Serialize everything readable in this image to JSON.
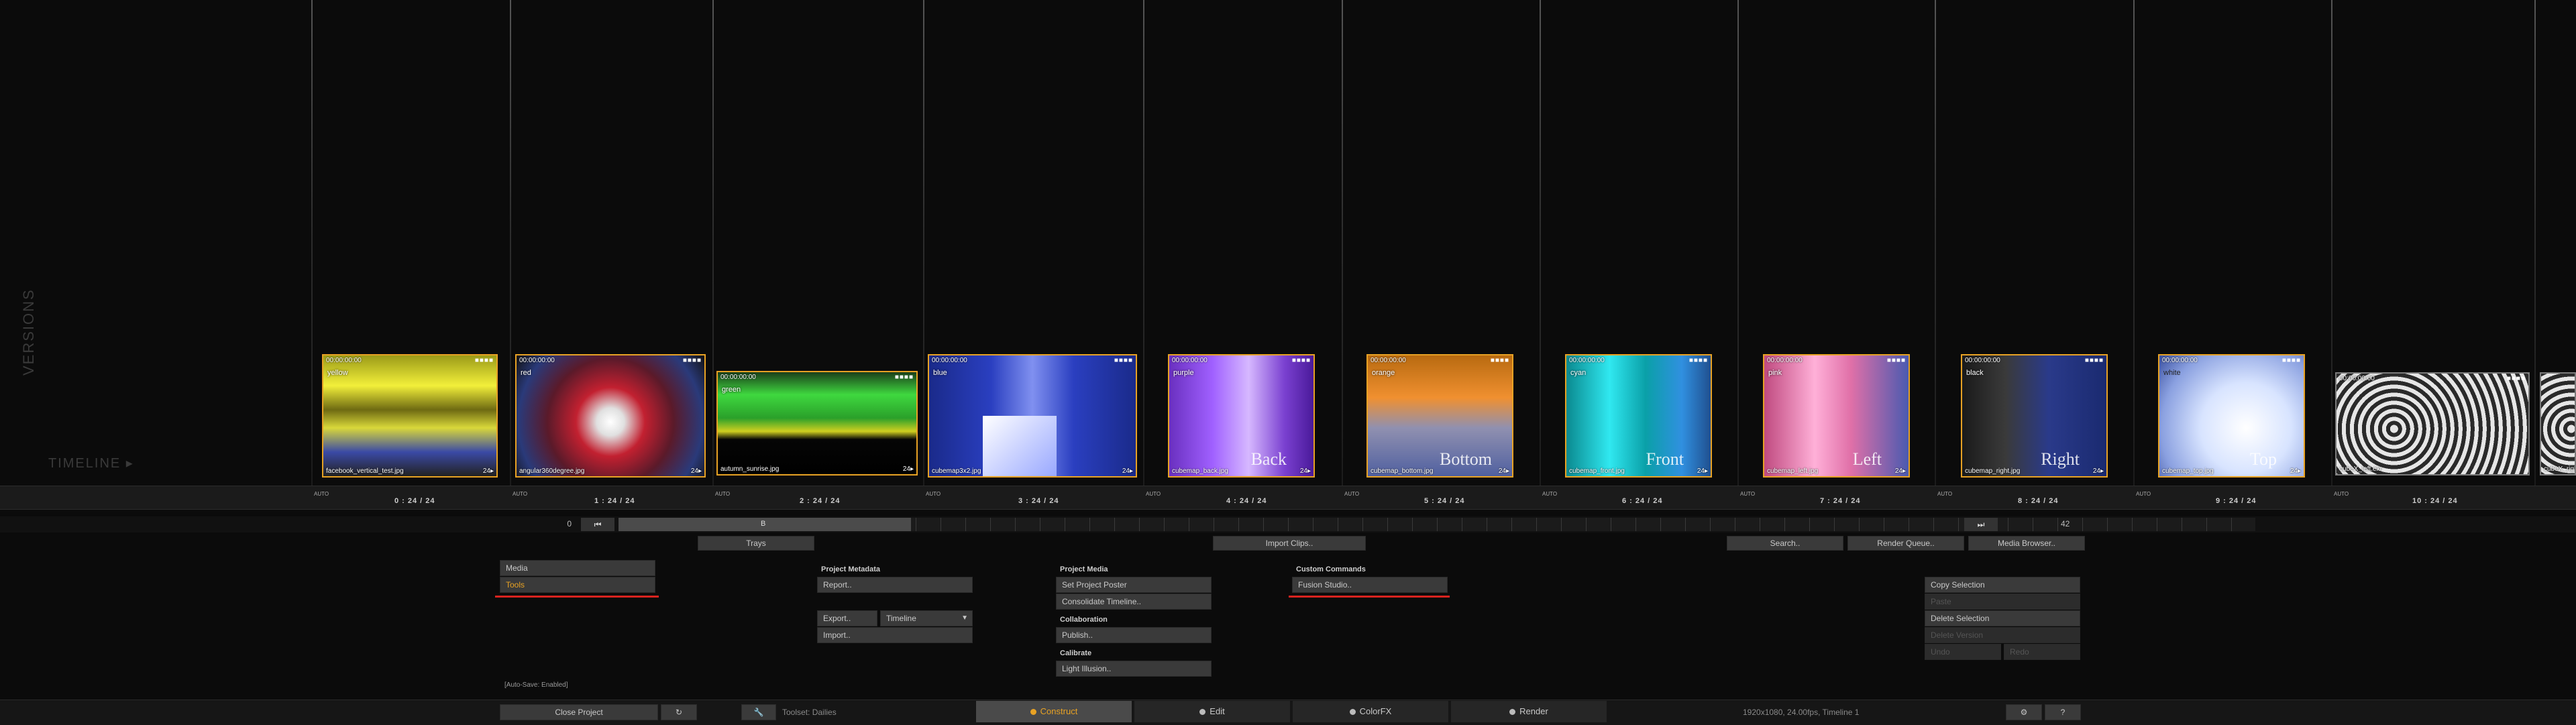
{
  "side": {
    "versions": "VERSIONS",
    "timeline": "TIMELINE ▸"
  },
  "clips": [
    {
      "tc": "00:00:00:00",
      "tag": "yellow",
      "file": "facebook_vertical_test.jpg",
      "badge": "24▸",
      "count": "0 : 24 / 24",
      "face": ""
    },
    {
      "tc": "00:00:00:00",
      "tag": "red",
      "file": "angular360degree.jpg",
      "badge": "24▸",
      "count": "1 : 24 / 24",
      "face": ""
    },
    {
      "tc": "00:00:00:00",
      "tag": "green",
      "file": "autumn_sunrise.jpg",
      "badge": "24▸",
      "count": "2 : 24 / 24",
      "face": ""
    },
    {
      "tc": "00:00:00:00",
      "tag": "blue",
      "file": "cubemap3x2.jpg",
      "badge": "24▸",
      "count": "3 : 24 / 24",
      "face": ""
    },
    {
      "tc": "00:00:00:00",
      "tag": "purple",
      "file": "cubemap_back.jpg",
      "badge": "24▸",
      "count": "4 : 24 / 24",
      "face": "Back"
    },
    {
      "tc": "00:00:00:00",
      "tag": "orange",
      "file": "cubemap_bottom.jpg",
      "badge": "24▸",
      "count": "5 : 24 / 24",
      "face": "Bottom"
    },
    {
      "tc": "00:00:00:00",
      "tag": "cyan",
      "file": "cubemap_front.jpg",
      "badge": "24▸",
      "count": "6 : 24 / 24",
      "face": "Front"
    },
    {
      "tc": "00:00:00:00",
      "tag": "pink",
      "file": "cubemap_left.jpg",
      "badge": "24▸",
      "count": "7 : 24 / 24",
      "face": "Left"
    },
    {
      "tc": "00:00:00:00",
      "tag": "black",
      "file": "cubemap_right.jpg",
      "badge": "24▸",
      "count": "8 : 24 / 24",
      "face": "Right"
    },
    {
      "tc": "00:00:00:00",
      "tag": "white",
      "file": "cubemap_top.jpg",
      "badge": "24▸",
      "count": "9 : 24 / 24",
      "face": "Top"
    },
    {
      "tc": "00:00:00:00",
      "tag": "",
      "file": "cubeX_left.exr",
      "badge": "",
      "count": "10 : 24 / 24",
      "face": ""
    },
    {
      "tc": "",
      "tag": "",
      "file": "cubeX_right",
      "badge": "",
      "count": "",
      "face": ""
    }
  ],
  "auto_label": "AUTO",
  "transport": {
    "start_frame": "0",
    "marker": "B",
    "end_frame": "42"
  },
  "toolbar": {
    "trays": "Trays",
    "import_clips": "Import Clips..",
    "search": "Search..",
    "render_queue": "Render Queue..",
    "media_browser": "Media Browser.."
  },
  "left_menu": {
    "media": "Media",
    "tools": "Tools"
  },
  "project_metadata": {
    "header": "Project Metadata",
    "report": "Report..",
    "export": "Export..",
    "export_option": "Timeline",
    "import": "Import.."
  },
  "project_media": {
    "header": "Project Media",
    "set_poster": "Set Project Poster",
    "consolidate": "Consolidate Timeline..",
    "collab_header": "Collaboration",
    "publish": "Publish..",
    "calibrate_header": "Calibrate",
    "light_illusion": "Light Illusion.."
  },
  "custom_commands": {
    "header": "Custom Commands",
    "fusion": "Fusion Studio.."
  },
  "edit_panel": {
    "copy": "Copy Selection",
    "paste": "Paste",
    "delete": "Delete Selection",
    "delete_version": "Delete Version",
    "undo": "Undo",
    "redo": "Redo"
  },
  "autosave": "[Auto-Save: Enabled]",
  "bottom": {
    "close_project": "Close Project",
    "toolset": "Toolset: Dailies",
    "tabs": [
      "Construct",
      "Edit",
      "ColorFX",
      "Render"
    ],
    "status": "1920x1080, 24.00fps, Timeline 1",
    "help": "?"
  },
  "colors": {
    "accent": "#e8a224",
    "underline": "#d9231f"
  }
}
